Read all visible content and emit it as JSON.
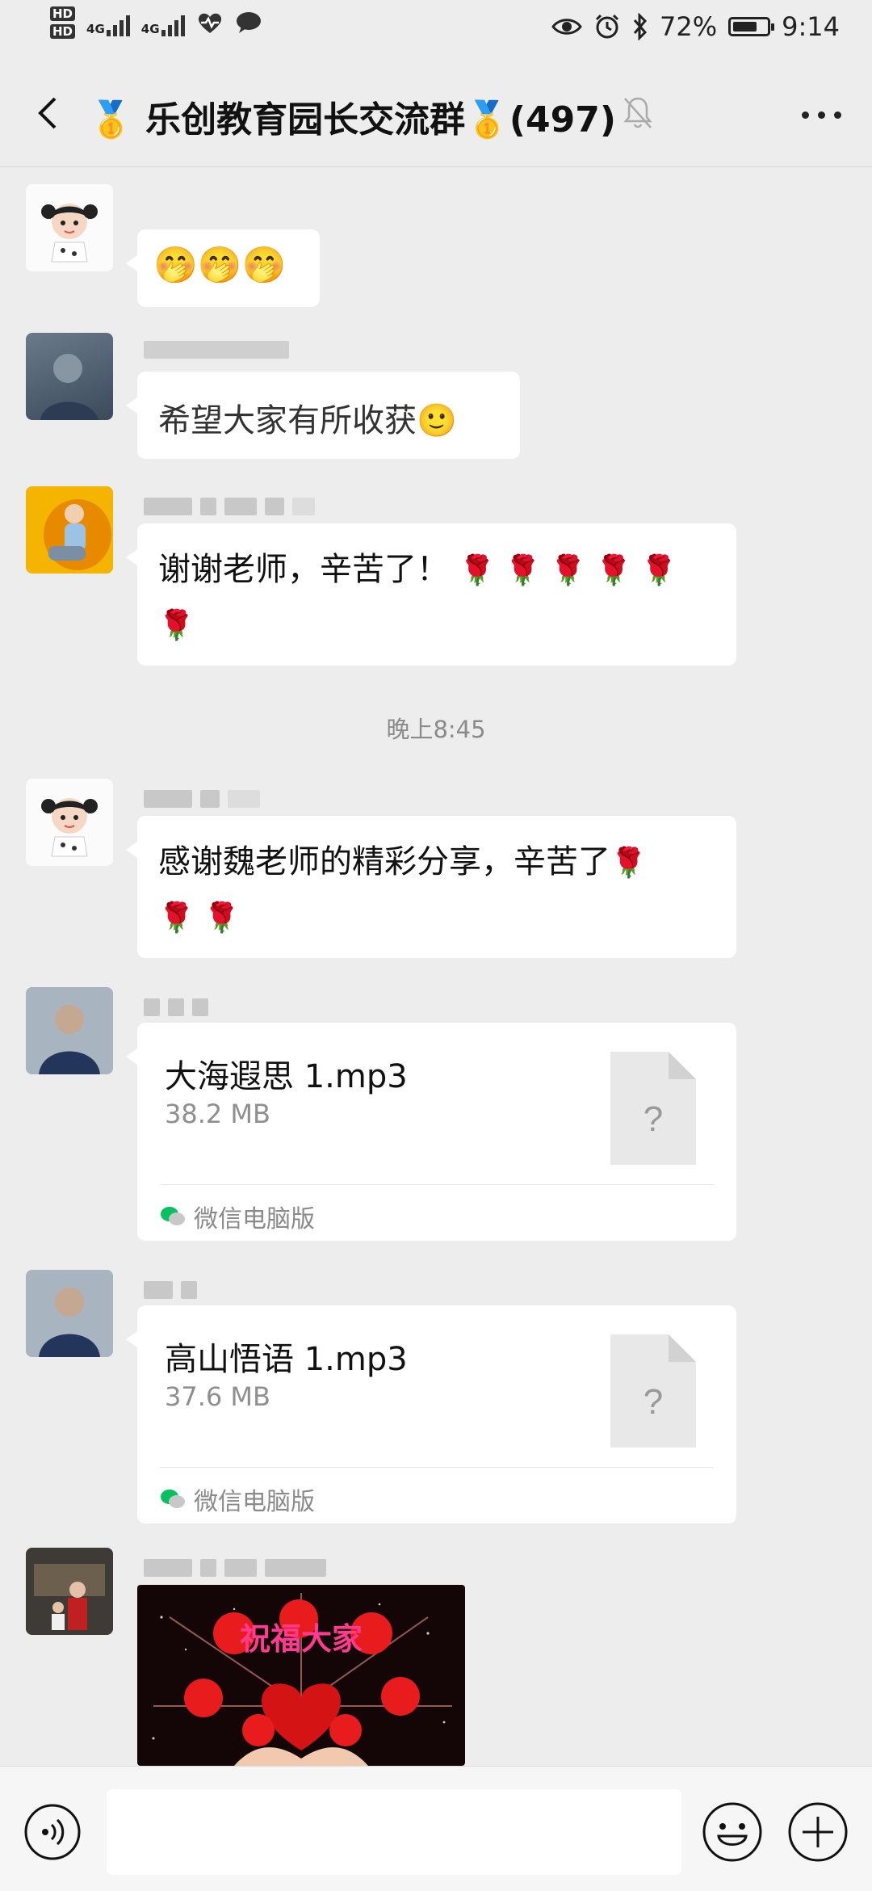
{
  "status_bar": {
    "hd1": "HD",
    "hd2": "HD",
    "net1": "4G",
    "net2": "4G",
    "battery_percent": "72%",
    "battery_level": 0.72,
    "time": "9:14"
  },
  "header": {
    "title": "🥇 乐创教育园长交流群🥇(497)"
  },
  "messages": {
    "m1": {
      "text": "🤭🤭🤭"
    },
    "m2": {
      "text": "希望大家有所收获🙂"
    },
    "m3": {
      "text_line1": "谢谢老师，辛苦了！",
      "roses_line1": "🌹 🌹 🌹 🌹 🌹",
      "roses_line2": "🌹"
    },
    "timestamp": "晚上8:45",
    "m4": {
      "text_line1": "感谢魏老师的精彩分享，辛苦了",
      "rose_end": "🌹",
      "roses_line2": "🌹 🌹"
    },
    "file1": {
      "name": "大海遐思 1.mp3",
      "size": "38.2 MB",
      "source": "微信电脑版",
      "icon_char": "?"
    },
    "file2": {
      "name": "高山悟语 1.mp3",
      "size": "37.6 MB",
      "source": "微信电脑版",
      "icon_char": "?"
    },
    "image_caption": "祝福大家"
  },
  "colors": {
    "background": "#ededed",
    "bubble": "#ffffff",
    "wechat_green": "#07c160",
    "rose_red": "#c8102e"
  }
}
